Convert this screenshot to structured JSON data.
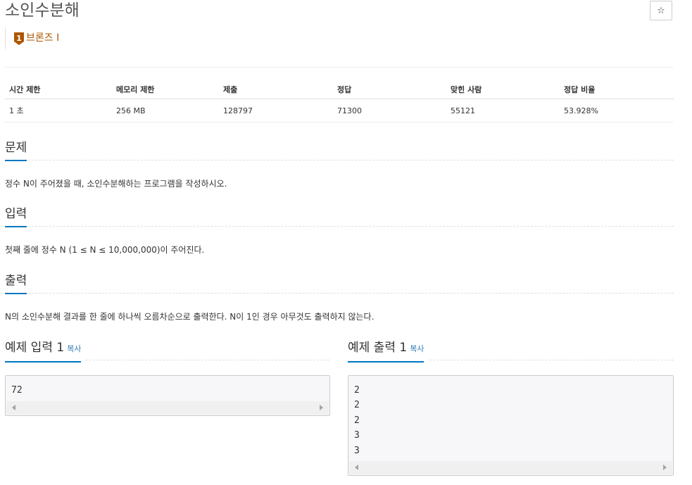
{
  "problem": {
    "title": "소인수분해",
    "star_icon": "☆",
    "tier": {
      "label": "브론즈 I",
      "icon": "tier-bronze-1-icon",
      "icon_digit": "1",
      "color": "#ad5600"
    }
  },
  "info_table": {
    "headers": [
      "시간 제한",
      "메모리 제한",
      "제출",
      "정답",
      "맞힌 사람",
      "정답 비율"
    ],
    "row": [
      "1 초",
      "256 MB",
      "128797",
      "71300",
      "55121",
      "53.928%"
    ]
  },
  "sections": {
    "description": {
      "title": "문제",
      "text": "정수 N이 주어졌을 때, 소인수분해하는 프로그램을 작성하시오."
    },
    "input": {
      "title": "입력",
      "text": "첫째 줄에 정수 N (1 ≤ N ≤ 10,000,000)이 주어진다."
    },
    "output": {
      "title": "출력",
      "text": "N의 소인수분해 결과를 한 줄에 하나씩 오름차순으로 출력한다. N이 1인 경우 아무것도 출력하지 않는다."
    }
  },
  "examples": {
    "input": {
      "title": "예제 입력 1",
      "copy": "복사",
      "lines": [
        "72"
      ]
    },
    "output": {
      "title": "예제 출력 1",
      "copy": "복사",
      "lines": [
        "2",
        "2",
        "2",
        "3",
        "3"
      ]
    }
  },
  "colors": {
    "accent": "#0076c0",
    "link": "#337ab7",
    "tier": "#ad5600"
  }
}
